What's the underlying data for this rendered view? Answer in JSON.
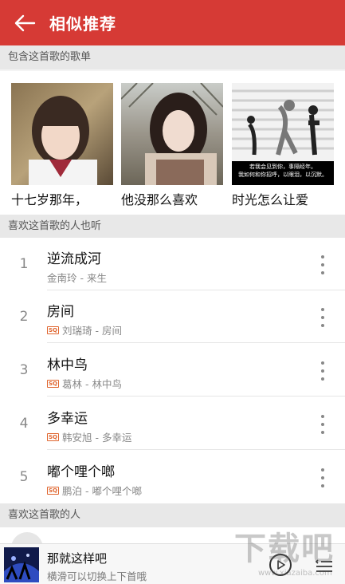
{
  "header": {
    "title": "相似推荐",
    "back_icon": "arrow-left-icon"
  },
  "sections": {
    "playlists_title": "包含这首歌的歌单",
    "also_listen_title": "喜欢这首歌的人也听",
    "listeners_title": "喜欢这首歌的人"
  },
  "playlists": [
    {
      "caption": "十七岁那年，"
    },
    {
      "caption": "他没那么喜欢"
    },
    {
      "caption": "时光怎么让爱"
    }
  ],
  "playlist_overlay_text": {
    "line1": "若我会见到你，事隔经年。",
    "line2": "我如何和你招呼，以眼泪，以沉默。"
  },
  "songs": [
    {
      "index": "1",
      "name": "逆流成河",
      "artist_album": "金南玲 - 来生",
      "sq": false
    },
    {
      "index": "2",
      "name": "房间",
      "artist_album": "刘瑞琦 - 房间",
      "sq": true
    },
    {
      "index": "3",
      "name": "林中鸟",
      "artist_album": "葛林 - 林中鸟",
      "sq": true
    },
    {
      "index": "4",
      "name": "多幸运",
      "artist_album": "韩安旭 - 多幸运",
      "sq": true
    },
    {
      "index": "5",
      "name": "嘟个哩个啷",
      "artist_album": "鹏泊 - 嘟个哩个啷",
      "sq": true
    }
  ],
  "sq_badge": "SQ",
  "player": {
    "title": "那就这样吧",
    "hint": "横滑可以切换上下首哦"
  },
  "watermark": {
    "text": "下载吧",
    "url": "www.xiazaiba.com"
  },
  "colors": {
    "accent": "#d63a35",
    "sq": "#e0652e"
  }
}
